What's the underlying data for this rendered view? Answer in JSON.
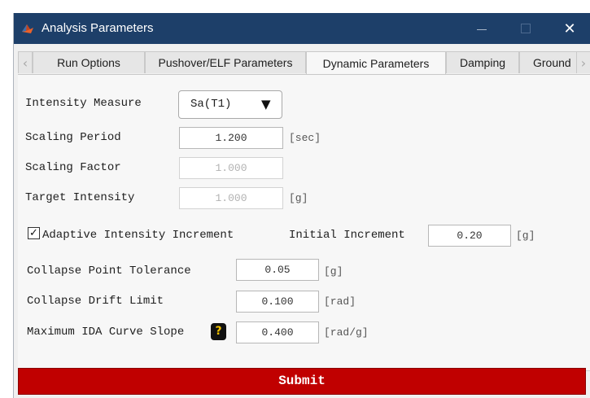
{
  "window": {
    "title": "Analysis Parameters",
    "close_glyph": "✕"
  },
  "tabs": [
    {
      "label": "Run Options"
    },
    {
      "label": "Pushover/ELF Parameters"
    },
    {
      "label": "Dynamic Parameters",
      "active": true
    },
    {
      "label": "Damping"
    },
    {
      "label": "Ground"
    }
  ],
  "tab_scroll": {
    "left": "‹",
    "right": "›"
  },
  "form": {
    "intensity_measure": {
      "label": "Intensity Measure",
      "value": "Sa(T1)",
      "caret": "▼"
    },
    "scaling_period": {
      "label": "Scaling Period",
      "value": "1.200",
      "unit": "[sec]"
    },
    "scaling_factor": {
      "label": "Scaling Factor",
      "value": "1.000"
    },
    "target_intensity": {
      "label": "Target Intensity",
      "value": "1.000",
      "unit": "[g]"
    },
    "adaptive": {
      "checked_glyph": "✓",
      "label": "Adaptive Intensity Increment",
      "checked": true
    },
    "initial_increment": {
      "label": "Initial Increment",
      "value": "0.20",
      "unit": "[g]"
    },
    "collapse_tolerance": {
      "label": "Collapse Point Tolerance",
      "value": "0.05",
      "unit": "[g]"
    },
    "collapse_drift": {
      "label": "Collapse Drift Limit",
      "value": "0.100",
      "unit": "[rad]"
    },
    "max_slope": {
      "label": "Maximum IDA Curve Slope",
      "help": "?",
      "value": "0.400",
      "unit": "[rad/g]"
    }
  },
  "submit_label": "Submit",
  "colors": {
    "titlebar": "#1d3f69",
    "submit": "#c00000",
    "help_badge": "#111111"
  }
}
